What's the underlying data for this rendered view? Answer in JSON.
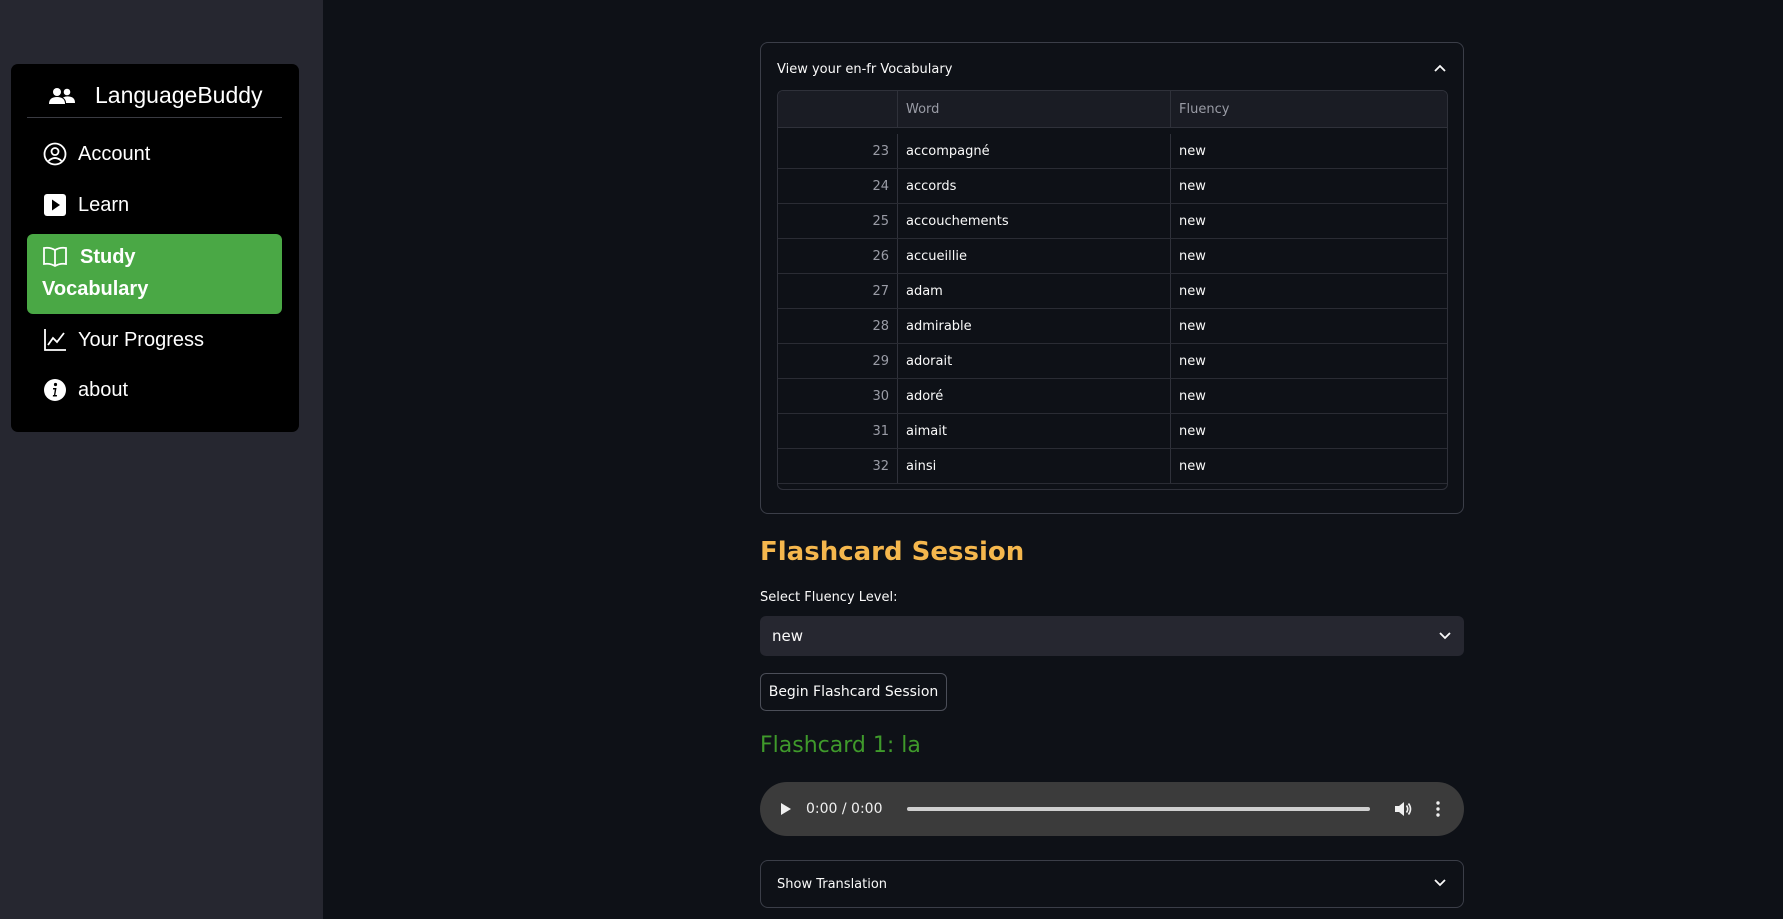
{
  "sidebar": {
    "title": "LanguageBuddy",
    "items": [
      {
        "label": "Account",
        "icon": "user-circle-icon"
      },
      {
        "label": "Learn",
        "icon": "play-square-icon"
      },
      {
        "label_line1": "Study",
        "label_line2": "Vocabulary",
        "icon": "book-icon",
        "active": true
      },
      {
        "label": "Your Progress",
        "icon": "chart-line-icon"
      },
      {
        "label": "about",
        "icon": "info-circle-icon"
      }
    ],
    "active_color": "#4aa845"
  },
  "vocab_expander": {
    "title": "View your en-fr Vocabulary",
    "columns": [
      "",
      "Word",
      "Fluency"
    ],
    "rows": [
      {
        "index": "23",
        "word": "accompagné",
        "fluency": "new"
      },
      {
        "index": "24",
        "word": "accords",
        "fluency": "new"
      },
      {
        "index": "25",
        "word": "accouchements",
        "fluency": "new"
      },
      {
        "index": "26",
        "word": "accueillie",
        "fluency": "new"
      },
      {
        "index": "27",
        "word": "adam",
        "fluency": "new"
      },
      {
        "index": "28",
        "word": "admirable",
        "fluency": "new"
      },
      {
        "index": "29",
        "word": "adorait",
        "fluency": "new"
      },
      {
        "index": "30",
        "word": "adoré",
        "fluency": "new"
      },
      {
        "index": "31",
        "word": "aimait",
        "fluency": "new"
      },
      {
        "index": "32",
        "word": "ainsi",
        "fluency": "new"
      }
    ]
  },
  "flashcard": {
    "section_title": "Flashcard Session",
    "select_label": "Select Fluency Level:",
    "select_value": "new",
    "begin_button": "Begin Flashcard Session",
    "card_title": "Flashcard 1: la",
    "audio_time": "0:00 / 0:00",
    "translation_expander": "Show Translation"
  },
  "colors": {
    "section_title": "#f5b74d",
    "flashcard_title": "#3f9a2b"
  }
}
